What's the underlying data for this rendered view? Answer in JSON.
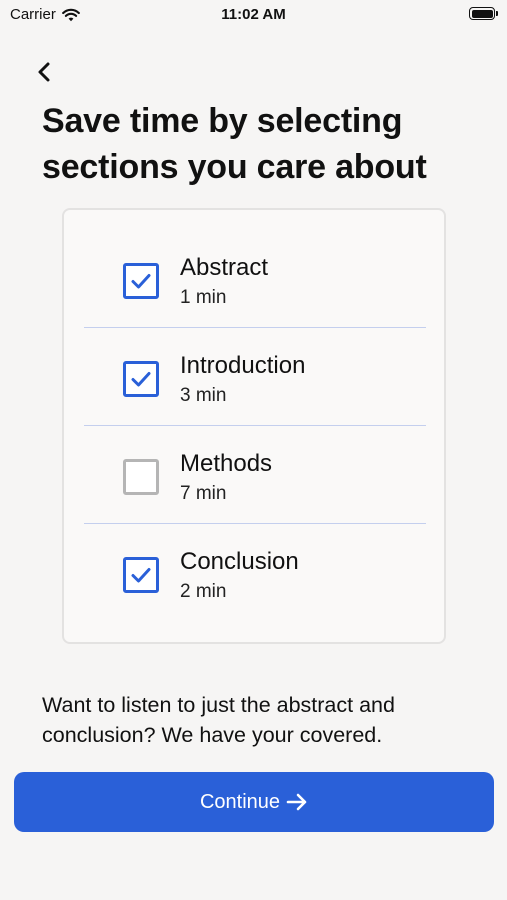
{
  "status_bar": {
    "carrier": "Carrier",
    "time": "11:02 AM",
    "battery_level": 1.0
  },
  "header": {
    "back_icon": "chevron-left-icon",
    "title": "Save time by selecting sections you care about"
  },
  "sections": [
    {
      "name": "Abstract",
      "duration": "1 min",
      "checked": true
    },
    {
      "name": "Introduction",
      "duration": "3 min",
      "checked": true
    },
    {
      "name": "Methods",
      "duration": "7 min",
      "checked": false
    },
    {
      "name": "Conclusion",
      "duration": "2 min",
      "checked": true
    }
  ],
  "promo_text": "Want to listen to just the abstract and conclusion? We have your covered.",
  "continue_button": {
    "label": "Continue",
    "icon": "arrow-right-icon"
  },
  "colors": {
    "accent": "#2a60d8",
    "background": "#f6f5f4",
    "checkbox_unchecked": "#b5b5b5",
    "divider": "#c4cfee"
  }
}
